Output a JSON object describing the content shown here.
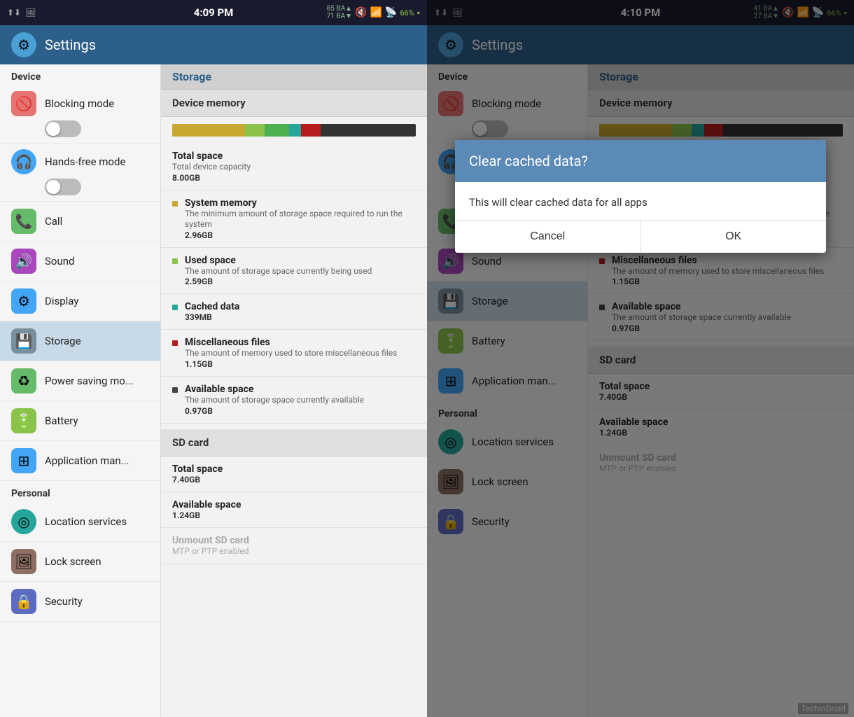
{
  "left_panel": {
    "status_bar": {
      "time": "4:09 PM",
      "battery": "66%"
    },
    "header": {
      "title": "Settings",
      "icon": "⚙"
    },
    "sidebar": {
      "section_device": "Device",
      "items_device": [
        {
          "id": "blocking-mode",
          "label": "Blocking mode",
          "icon": "🚫",
          "icon_bg": "#e57373",
          "has_toggle": true
        },
        {
          "id": "hands-free-mode",
          "label": "Hands-free mode",
          "icon": "🎧",
          "icon_bg": "#42a5f5",
          "has_toggle": true
        },
        {
          "id": "call",
          "label": "Call",
          "icon": "📞",
          "icon_bg": "#66bb6a"
        },
        {
          "id": "sound",
          "label": "Sound",
          "icon": "🔊",
          "icon_bg": "#ab47bc"
        },
        {
          "id": "display",
          "label": "Display",
          "icon": "⚙",
          "icon_bg": "#42a5f5"
        },
        {
          "id": "storage",
          "label": "Storage",
          "icon": "💾",
          "icon_bg": "#78909c",
          "active": true
        },
        {
          "id": "power-saving",
          "label": "Power saving mo...",
          "icon": "♻",
          "icon_bg": "#66bb6a"
        },
        {
          "id": "battery",
          "label": "Battery",
          "icon": "🔋",
          "icon_bg": "#8bc34a"
        },
        {
          "id": "application-man",
          "label": "Application man...",
          "icon": "⊞",
          "icon_bg": "#42a5f5"
        }
      ],
      "section_personal": "Personal",
      "items_personal": [
        {
          "id": "location-services",
          "label": "Location services",
          "icon": "◎",
          "icon_bg": "#26a69a"
        },
        {
          "id": "lock-screen",
          "label": "Lock screen",
          "icon": "🖼",
          "icon_bg": "#8d6e63"
        },
        {
          "id": "security",
          "label": "Security",
          "icon": "🔒",
          "icon_bg": "#5c6bc0"
        }
      ]
    },
    "content": {
      "section_title": "Storage",
      "device_memory_title": "Device memory",
      "storage_bar": [
        {
          "color": "#c8a830",
          "width": 30
        },
        {
          "color": "#8bc34a",
          "width": 8
        },
        {
          "color": "#4caf50",
          "width": 10
        },
        {
          "color": "#26a69a",
          "width": 5
        },
        {
          "color": "#b71c1c",
          "width": 8
        },
        {
          "color": "#333",
          "width": 39
        }
      ],
      "items": [
        {
          "title": "Total space",
          "desc": "Total device capacity",
          "value": "8.00GB",
          "color": null
        },
        {
          "title": "System memory",
          "desc": "The minimum amount of storage space required to run the system",
          "value": "2.96GB",
          "color": "#c8a830"
        },
        {
          "title": "Used space",
          "desc": "The amount of storage space currently being used",
          "value": "2.59GB",
          "color": "#8bc34a"
        },
        {
          "title": "Cached data",
          "desc": "",
          "value": "339MB",
          "color": "#26a69a"
        },
        {
          "title": "Miscellaneous files",
          "desc": "The amount of memory used to store miscellaneous files",
          "value": "1.15GB",
          "color": "#b71c1c"
        },
        {
          "title": "Available space",
          "desc": "The amount of storage space currently available",
          "value": "0.97GB",
          "color": "#444"
        }
      ],
      "sd_card_title": "SD card",
      "sd_items": [
        {
          "title": "Total space",
          "value": "7.40GB"
        },
        {
          "title": "Available space",
          "value": "1.24GB"
        },
        {
          "title": "Unmount SD card",
          "value": "",
          "grayed": true
        },
        {
          "title": "MTP or PTP enabled",
          "value": "",
          "grayed": true
        }
      ]
    }
  },
  "right_panel": {
    "status_bar": {
      "time": "4:10 PM",
      "battery": "66%"
    },
    "header": {
      "title": "Settings",
      "icon": "⚙"
    },
    "dialog": {
      "title": "Clear cached data?",
      "message": "This will clear cached data for all apps",
      "cancel_label": "Cancel",
      "ok_label": "OK"
    },
    "watermark": "TechinDroid"
  }
}
